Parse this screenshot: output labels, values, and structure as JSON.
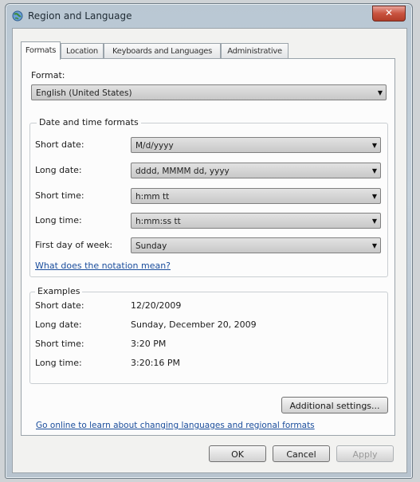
{
  "window": {
    "title": "Region and Language",
    "close_label": "✕"
  },
  "tabs": [
    {
      "label": "Formats",
      "active": true
    },
    {
      "label": "Location",
      "active": false
    },
    {
      "label": "Keyboards and Languages",
      "active": false
    },
    {
      "label": "Administrative",
      "active": false
    }
  ],
  "formats": {
    "format_label": "Format:",
    "format_value": "English (United States)",
    "dt_group_title": "Date and time formats",
    "short_date_label": "Short date:",
    "short_date_value": "M/d/yyyy",
    "long_date_label": "Long date:",
    "long_date_value": "dddd, MMMM dd, yyyy",
    "short_time_label": "Short time:",
    "short_time_value": "h:mm tt",
    "long_time_label": "Long time:",
    "long_time_value": "h:mm:ss tt",
    "first_day_label": "First day of week:",
    "first_day_value": "Sunday",
    "notation_link": "What does the notation mean?",
    "examples_title": "Examples",
    "examples": {
      "short_date_label": "Short date:",
      "short_date_value": "12/20/2009",
      "long_date_label": "Long date:",
      "long_date_value": "Sunday, December 20, 2009",
      "short_time_label": "Short time:",
      "short_time_value": "3:20 PM",
      "long_time_label": "Long time:",
      "long_time_value": "3:20:16 PM"
    },
    "additional_settings_label": "Additional settings...",
    "online_link": "Go online to learn about changing languages and regional formats"
  },
  "buttons": {
    "ok": "OK",
    "cancel": "Cancel",
    "apply": "Apply"
  }
}
